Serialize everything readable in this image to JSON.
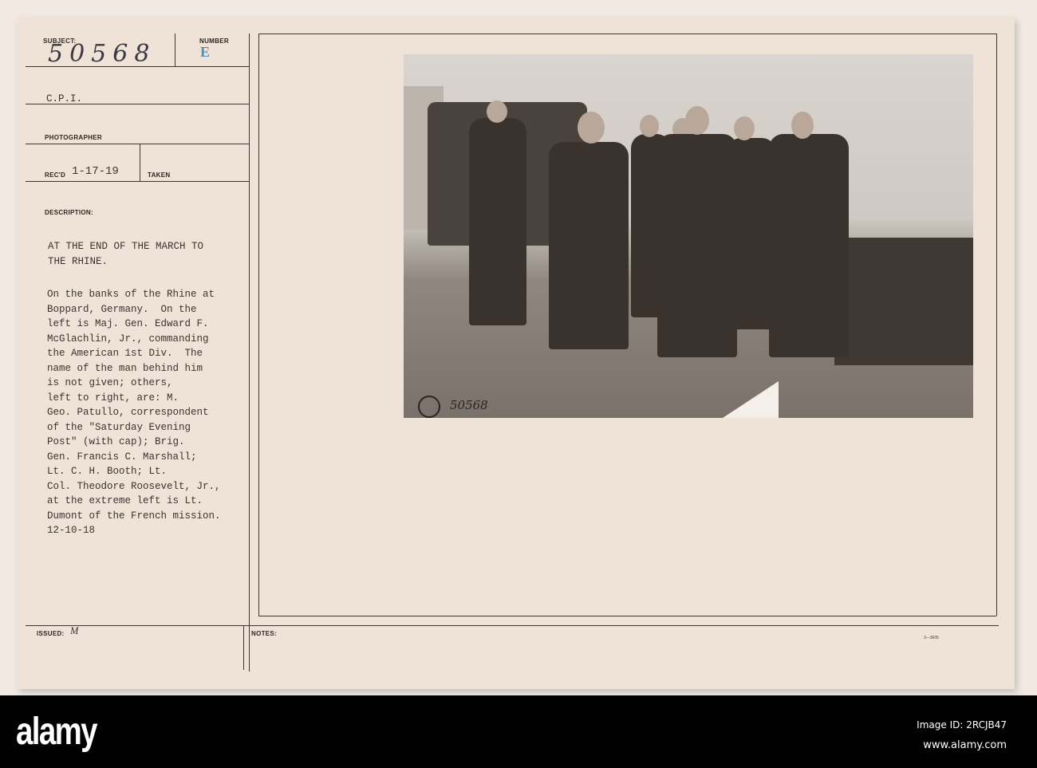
{
  "card": {
    "subject_label": "SUBJECT:",
    "subject_value": "50568",
    "number_label": "NUMBER",
    "number_stamp": "E",
    "cpi": "C.P.I.",
    "photographer_label": "PHOTOGRAPHER",
    "recd_label": "REC'D",
    "recd_value": "1-17-19",
    "taken_label": "TAKEN",
    "description_label": "DESCRIPTION:",
    "title_lines": [
      "AT THE END OF THE MARCH TO",
      "THE RHINE."
    ],
    "description_lines": [
      "On the banks of the Rhine at",
      "Boppard, Germany.  On the",
      "left is Maj. Gen. Edward F.",
      "McGlachlin, Jr., commanding",
      "the American 1st Div.  The",
      "name of the man behind him",
      "is not given; others,",
      "left to right, are: M.",
      "Geo. Patullo, correspondent",
      "of the \"Saturday Evening",
      "Post\" (with cap); Brig.",
      "Gen. Francis C. Marshall;",
      "Lt. C. H. Booth; Lt.",
      "Col. Theodore Roosevelt, Jr.,",
      "at the extreme left is Lt.",
      "Dumont of the French mission.",
      "12-10-18"
    ],
    "issued_label": "ISSUED:",
    "issued_value": "M",
    "notes_label": "NOTES:",
    "form_number": "3—3605",
    "photo_number": "50568"
  },
  "footer": {
    "logo": "alamy",
    "image_id": "Image ID: 2RCJB47",
    "url": "www.alamy.com"
  }
}
